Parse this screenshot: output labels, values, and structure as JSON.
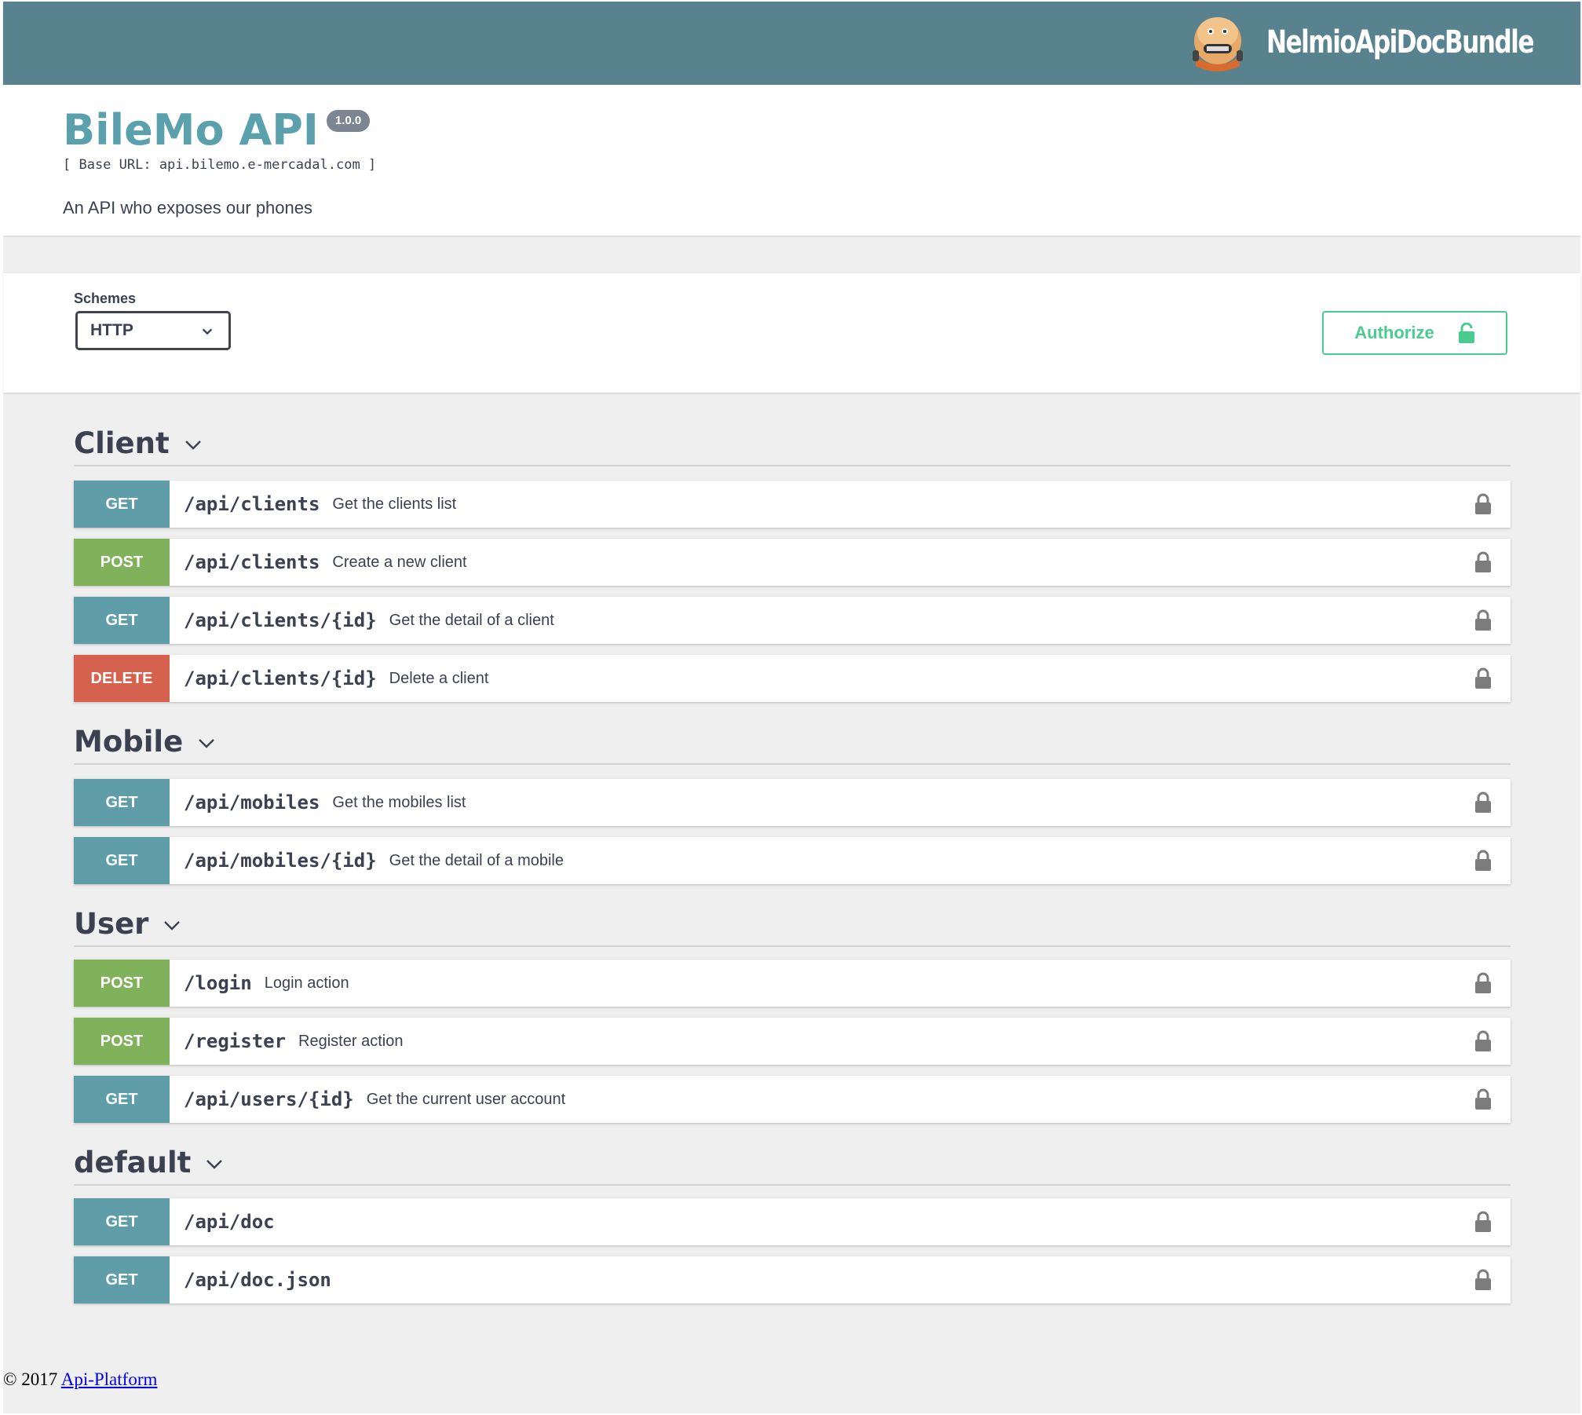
{
  "topbar": {
    "brand": "NelmioApiDocBundle",
    "logo_icon": "nelmio-robot-icon"
  },
  "info": {
    "title": "BileMo API",
    "version": "1.0.0",
    "base_url": "[ Base URL: api.bilemo.e-mercadal.com ]",
    "description": "An API who exposes our phones"
  },
  "schemes": {
    "label": "Schemes",
    "selected": "HTTP"
  },
  "authorize": {
    "label": "Authorize",
    "color": "#49cc90"
  },
  "colors": {
    "get": "#5f9ea9",
    "post": "#7fb25a",
    "delete": "#d5614f",
    "topbar": "#58838e"
  },
  "sections": [
    {
      "name": "Client",
      "operations": [
        {
          "method": "GET",
          "path": "/api/clients",
          "summary": "Get the clients list"
        },
        {
          "method": "POST",
          "path": "/api/clients",
          "summary": "Create a new client"
        },
        {
          "method": "GET",
          "path": "/api/clients/{id}",
          "summary": "Get the detail of a client"
        },
        {
          "method": "DELETE",
          "path": "/api/clients/{id}",
          "summary": "Delete a client"
        }
      ]
    },
    {
      "name": "Mobile",
      "operations": [
        {
          "method": "GET",
          "path": "/api/mobiles",
          "summary": "Get the mobiles list"
        },
        {
          "method": "GET",
          "path": "/api/mobiles/{id}",
          "summary": "Get the detail of a mobile"
        }
      ]
    },
    {
      "name": "User",
      "operations": [
        {
          "method": "POST",
          "path": "/login",
          "summary": "Login action"
        },
        {
          "method": "POST",
          "path": "/register",
          "summary": "Register action"
        },
        {
          "method": "GET",
          "path": "/api/users/{id}",
          "summary": "Get the current user account"
        }
      ]
    },
    {
      "name": "default",
      "operations": [
        {
          "method": "GET",
          "path": "/api/doc",
          "summary": ""
        },
        {
          "method": "GET",
          "path": "/api/doc.json",
          "summary": ""
        }
      ]
    }
  ],
  "footer": {
    "copyright": "© 2017 ",
    "link_text": "Api-Platform"
  }
}
